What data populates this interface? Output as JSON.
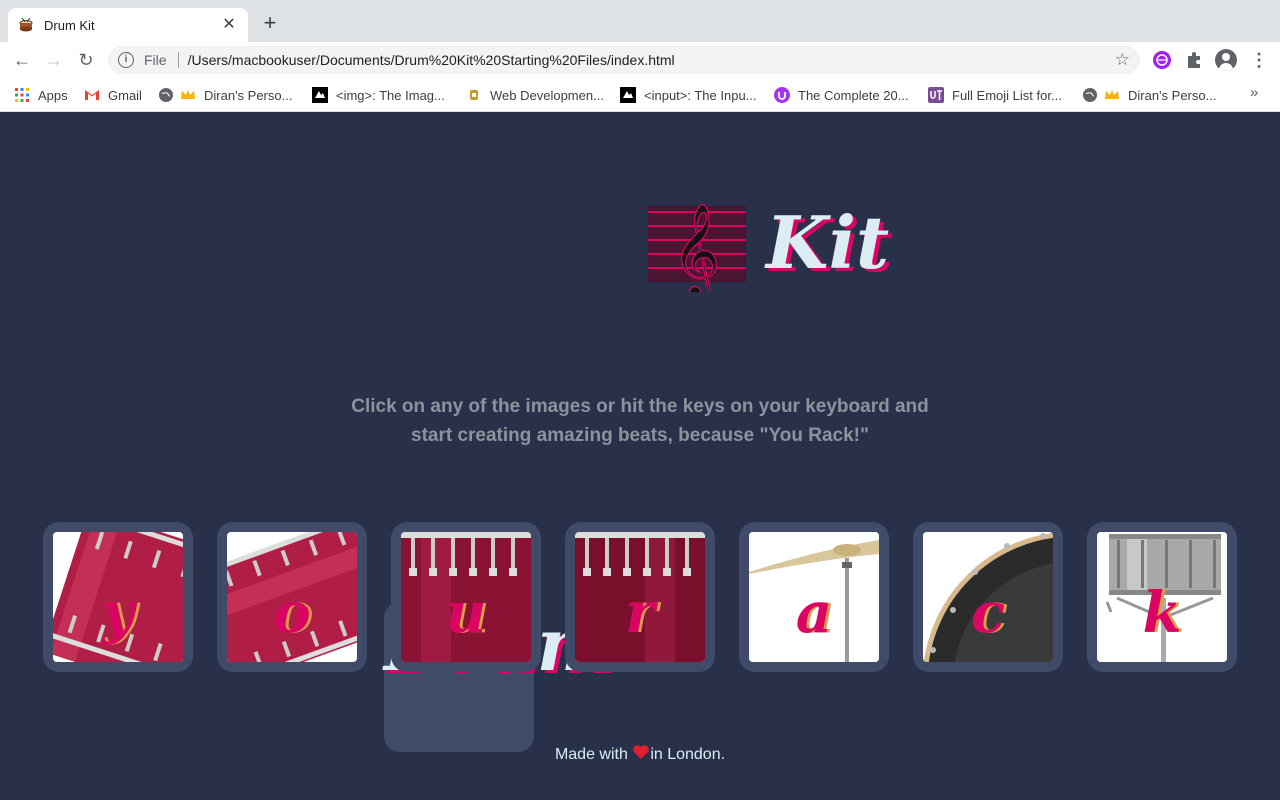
{
  "browser": {
    "tab_title": "Drum Kit",
    "url_scheme_label": "File",
    "url": "/Users/macbookuser/Documents/Drum%20Kit%20Starting%20Files/index.html",
    "bookmarks": [
      {
        "label": "Apps",
        "icon": "apps-grid-icon"
      },
      {
        "label": "Gmail",
        "icon": "gmail-icon"
      },
      {
        "label": "Diran's Perso...",
        "icon": "crown-icon"
      },
      {
        "label": "<img>: The Imag...",
        "icon": "mdn-icon"
      },
      {
        "label": "Web Developmen...",
        "icon": "course-icon"
      },
      {
        "label": "<input>: The Inpu...",
        "icon": "mdn-icon"
      },
      {
        "label": "The Complete 20...",
        "icon": "udemy-icon"
      },
      {
        "label": "Full Emoji List for...",
        "icon": "unicode-icon"
      },
      {
        "label": "Diran's Perso...",
        "icon": "crown-icon"
      }
    ]
  },
  "page": {
    "title_left": "Drum",
    "title_emoji": "musical-score-icon",
    "title_right": "Kit",
    "instructions_line1": "Click on any of the images or hit the keys on your keyboard and",
    "instructions_line2": "start creating amazing beats, because \"You Rack!\"",
    "drums": [
      {
        "letter": "y",
        "image": "tom-1"
      },
      {
        "letter": "o",
        "image": "tom-2"
      },
      {
        "letter": "u",
        "image": "tom-3"
      },
      {
        "letter": "r",
        "image": "tom-4"
      },
      {
        "letter": "a",
        "image": "crash"
      },
      {
        "letter": "c",
        "image": "kick"
      },
      {
        "letter": "k",
        "image": "snare"
      }
    ],
    "footer_before": "Made with",
    "footer_after": "in London."
  },
  "colors": {
    "background": "#283149",
    "button_frame": "#404b69",
    "accent_pink": "#da0463",
    "title_text": "#dbedf3"
  }
}
